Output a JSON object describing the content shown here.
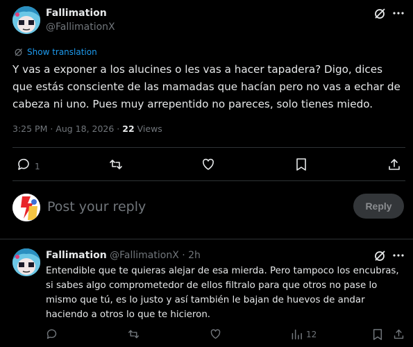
{
  "post": {
    "author_name": "Fallimation",
    "author_handle": "@FallimationX",
    "show_translation": "Show translation",
    "text": "Y vas a exponer a los alucines o les vas a hacer tapadera? Digo, dices que estás consciente de las mamadas que hacían pero no vas a echar de cabeza ni uno. Pues muy arrepentido no pareces, solo tienes miedo.",
    "timestamp": "3:25 PM · Aug 18, 2026 · ",
    "views_count": "22",
    "views_label": " Views",
    "reply_count": "1"
  },
  "composer": {
    "placeholder": "Post your reply",
    "reply_button": "Reply"
  },
  "reply": {
    "author_name": "Fallimation",
    "author_handle": "@FallimationX",
    "time": "· 2h",
    "text": "Entendible que te quieras alejar de esa mierda. Pero tampoco los encubras, si sabes algo comprometedor de ellos filtralo para que otros no pase lo mismo que tú, es lo justo y así también le bajan de huevos de andar haciendo a otros lo que te hicieron.",
    "views_count": "12"
  },
  "colors": {
    "background": "#000000",
    "text": "#e7e9ea",
    "muted": "#71767b",
    "link": "#1d9bf0",
    "divider": "#2f3336"
  }
}
